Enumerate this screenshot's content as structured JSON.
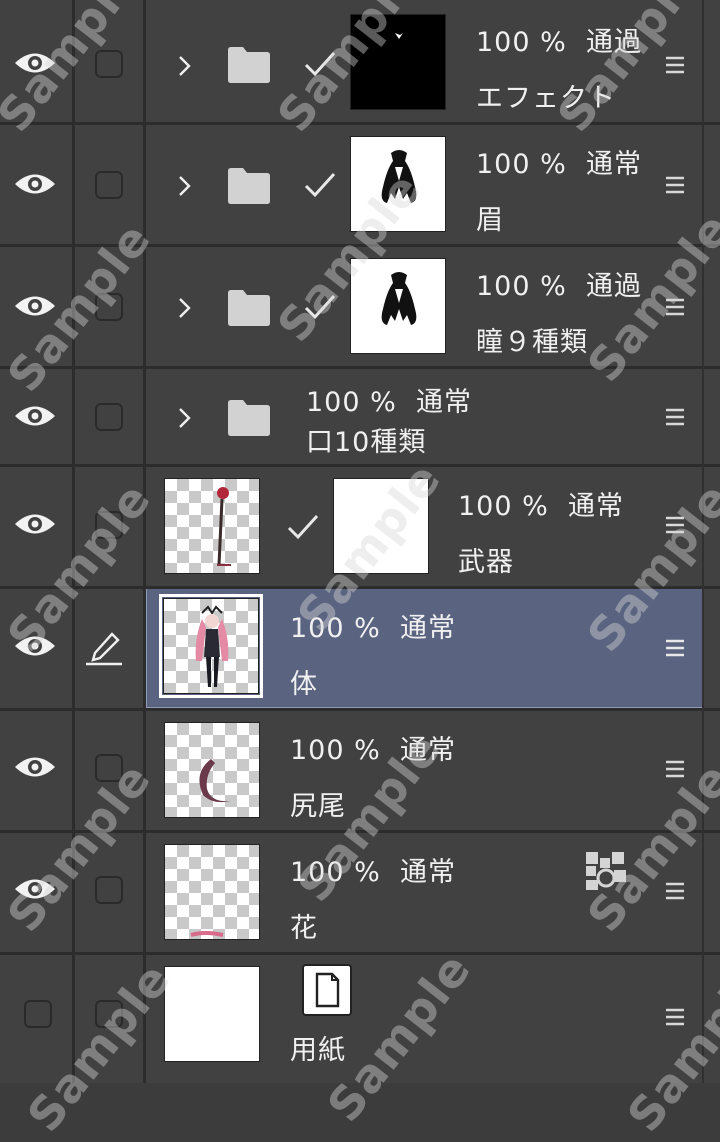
{
  "layers": [
    {
      "opacity": "100 %",
      "blend": "通過",
      "name": "エフェクト"
    },
    {
      "opacity": "100 %",
      "blend": "通常",
      "name": "眉"
    },
    {
      "opacity": "100 %",
      "blend": "通過",
      "name": "瞳９種類"
    },
    {
      "opacity": "100 %",
      "blend": "通常",
      "name": "口10種類"
    },
    {
      "opacity": "100 %",
      "blend": "通常",
      "name": "武器"
    },
    {
      "opacity": "100 %",
      "blend": "通常",
      "name": "体"
    },
    {
      "opacity": "100 %",
      "blend": "通常",
      "name": "尻尾"
    },
    {
      "opacity": "100 %",
      "blend": "通常",
      "name": "花"
    },
    {
      "name": "用紙"
    }
  ],
  "watermark": "Sample",
  "icons": [
    "eye-icon",
    "checkbox",
    "chevron-right-icon",
    "folder-icon",
    "check-icon",
    "pencil-icon",
    "menu-icon",
    "grid-pattern-icon",
    "paper-icon"
  ],
  "colors": {
    "panel": "#414141",
    "divider": "#2c2c2c",
    "selected": "#5a6480",
    "text": "#f0f0f0"
  }
}
